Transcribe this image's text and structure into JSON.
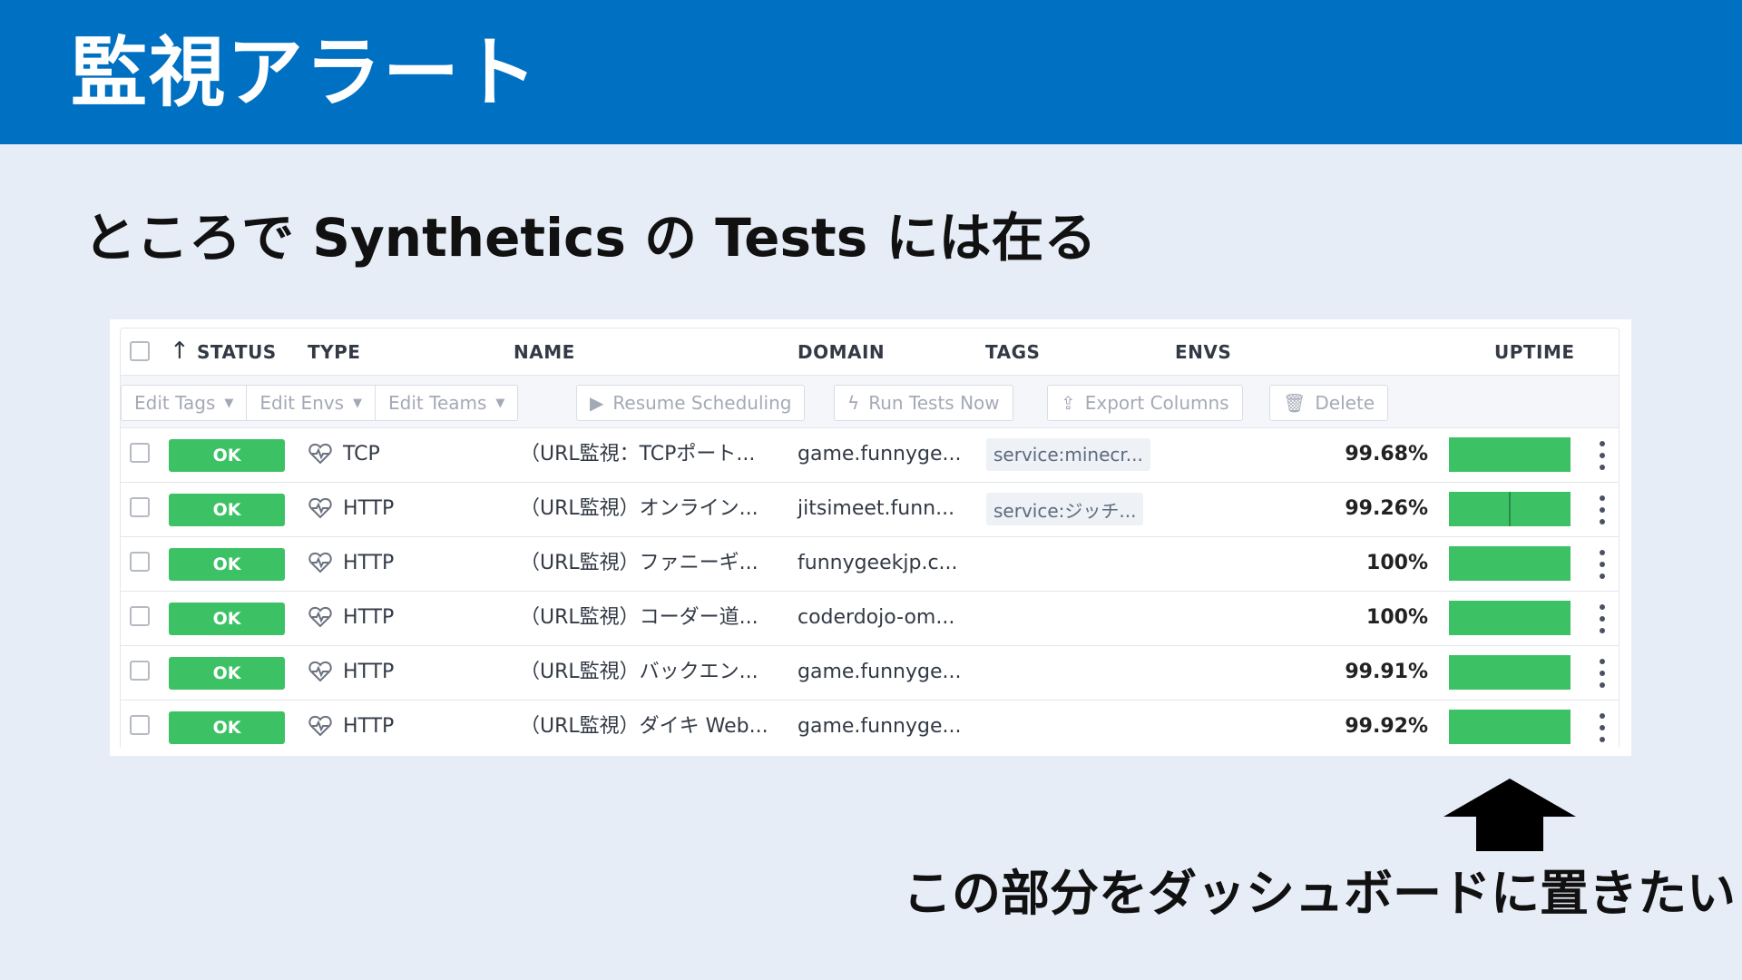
{
  "slide": {
    "title": "監視アラート",
    "subtitle": "ところで Synthetics の Tests には在る",
    "note": "この部分をダッシュボードに置きたい！"
  },
  "table": {
    "columns": {
      "status": "STATUS",
      "type": "TYPE",
      "name": "NAME",
      "domain": "DOMAIN",
      "tags": "TAGS",
      "envs": "ENVS",
      "uptime": "UPTIME"
    },
    "toolbar": {
      "edit_tags": "Edit Tags",
      "edit_envs": "Edit Envs",
      "edit_teams": "Edit Teams",
      "resume_scheduling": "Resume Scheduling",
      "run_tests_now": "Run Tests Now",
      "export_columns": "Export Columns",
      "delete": "Delete"
    },
    "rows": [
      {
        "status": "OK",
        "type": "TCP",
        "name": "（URL監視：TCPポート...",
        "domain": "game.funnyge...",
        "tag": "service:minecr...",
        "uptime": "99.68%"
      },
      {
        "status": "OK",
        "type": "HTTP",
        "name": "（URL監視）オンライン...",
        "domain": "jitsimeet.funn...",
        "tag": "service:ジッチ...",
        "uptime": "99.26%"
      },
      {
        "status": "OK",
        "type": "HTTP",
        "name": "（URL監視）ファニーギ...",
        "domain": "funnygeekjp.c...",
        "tag": "",
        "uptime": "100%"
      },
      {
        "status": "OK",
        "type": "HTTP",
        "name": "（URL監視）コーダー道...",
        "domain": "coderdojo-om...",
        "tag": "",
        "uptime": "100%"
      },
      {
        "status": "OK",
        "type": "HTTP",
        "name": "（URL監視）バックエン...",
        "domain": "game.funnyge...",
        "tag": "",
        "uptime": "99.91%"
      },
      {
        "status": "OK",
        "type": "HTTP",
        "name": "（URL監視）ダイキ Web...",
        "domain": "game.funnyge...",
        "tag": "",
        "uptime": "99.92%"
      }
    ]
  },
  "colors": {
    "header_blue": "#0070c2",
    "ok_green": "#3cc265",
    "background": "#e7edf7"
  }
}
